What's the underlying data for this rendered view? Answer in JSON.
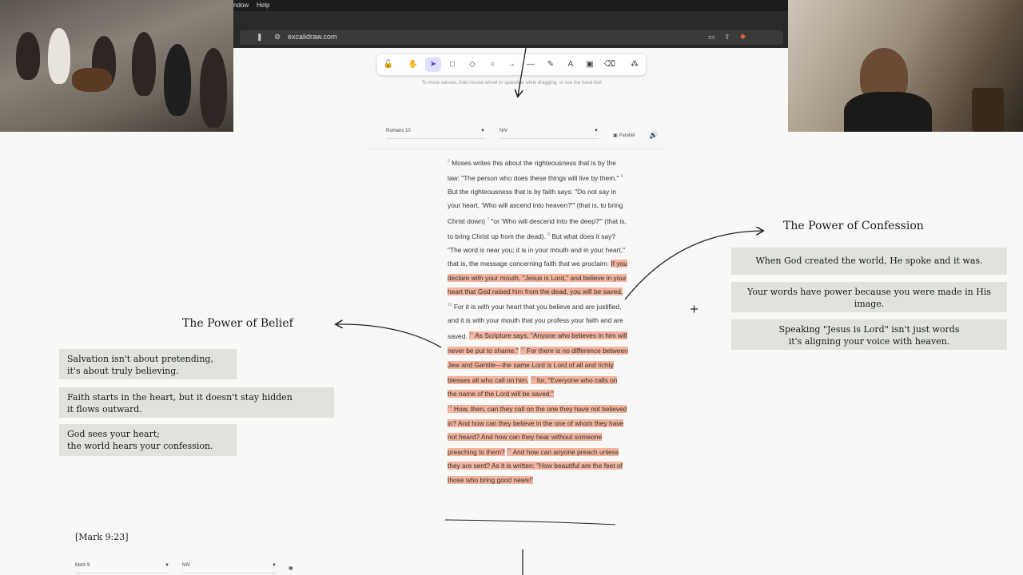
{
  "menubar": {
    "items": [
      "ndow",
      "Help"
    ]
  },
  "browser": {
    "url": "excalidraw.com"
  },
  "toolbar": {
    "tools": [
      {
        "name": "lock-tool",
        "glyph": "🔓"
      },
      {
        "name": "hand-tool",
        "glyph": "✋"
      },
      {
        "name": "selection-tool",
        "glyph": "➤"
      },
      {
        "name": "rectangle-tool",
        "glyph": "□"
      },
      {
        "name": "diamond-tool",
        "glyph": "◇"
      },
      {
        "name": "ellipse-tool",
        "glyph": "○"
      },
      {
        "name": "arrow-tool",
        "glyph": "→"
      },
      {
        "name": "line-tool",
        "glyph": "—"
      },
      {
        "name": "draw-tool",
        "glyph": "✎"
      },
      {
        "name": "text-tool",
        "glyph": "A"
      },
      {
        "name": "image-tool",
        "glyph": "▣"
      },
      {
        "name": "eraser-tool",
        "glyph": "⌫"
      },
      {
        "name": "extra-tools",
        "glyph": "⁂"
      }
    ],
    "hint": "To move canvas, hold mouse wheel or spacebar while dragging, or use the hand tool"
  },
  "reader": {
    "book_select": "Romans 10",
    "version_select": "NIV",
    "parallel_label": "Parallel"
  },
  "bible": {
    "v5": "Moses writes this about the righteousness that is by the law: \"The person who does these things will live by them.\"",
    "v6": "But the righteousness that is by faith says: \"Do not say in your heart, 'Who will ascend into heaven?'\"",
    "v6b": "(that is, to bring Christ down)",
    "v7": "\"or 'Who will descend into the deep?'\"",
    "v7b": "(that is, to bring Christ up from the dead).",
    "v8": "But what does it say? \"The word is near you; it is in your mouth and in your heart,\"",
    "v8b": "that is, the message concerning faith that we proclaim:",
    "v9": "If you declare with your mouth, \"Jesus is Lord,\" and believe in your heart that God raised him from the dead, you will be saved.",
    "v10": "For it is with your heart that you believe and are justified, and it is with your mouth that you profess your faith and are saved.",
    "v11": "As Scripture says, \"Anyone who believes in him will never be put to shame.\"",
    "v12": "For there is no difference between Jew and Gentile—the same Lord is Lord of all and richly blesses all who call on him,",
    "v13": "for, \"Everyone who calls on the name of the Lord will be saved.\"",
    "v14": "How, then, can they call on the one they have not believed in? And how can they believe in the one of whom they have not heard? And how can they hear without someone preaching to them?",
    "v15": "And how can anyone preach unless they are sent? As it is written: \"How beautiful are the feet of those who bring good news!\"",
    "nums": [
      "5",
      "6",
      "7",
      "8",
      "10",
      "11",
      "12",
      "13",
      "14",
      "15"
    ]
  },
  "belief": {
    "title": "The Power of Belief",
    "notes": [
      [
        "Salvation isn't about pretending,",
        "it's about truly believing."
      ],
      [
        "Faith starts in the heart, but it doesn't stay hidden",
        "it flows outward."
      ],
      [
        "God sees your heart;",
        "the world hears your confession."
      ]
    ]
  },
  "confession": {
    "title": "The Power of Confession",
    "notes": [
      [
        "When God created the world, He spoke and it was."
      ],
      [
        "Your words have power because you were made in His",
        "image."
      ],
      [
        "Speaking \"Jesus is Lord\" isn't just words",
        "it's aligning your voice with heaven."
      ]
    ]
  },
  "bottom_reader": {
    "reference": "[Mark 9:23]",
    "book_select": "Mark 9",
    "version_select": "NIV"
  }
}
